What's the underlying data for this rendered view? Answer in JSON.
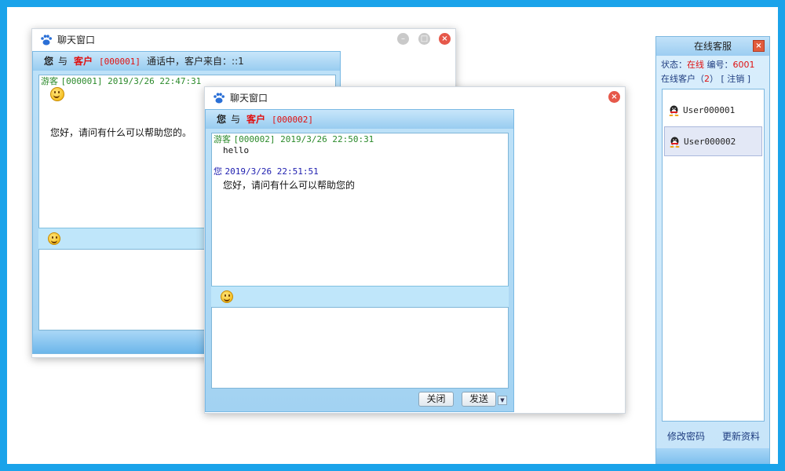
{
  "window1": {
    "title": "聊天窗口",
    "header": {
      "you": "您",
      "with": "与",
      "role": "客户",
      "code": "[000001]",
      "status": "通话中，客户来自：::1"
    },
    "messages": [
      {
        "sender": "游客",
        "meta": "[000001] 2019/3/26 22:47:31",
        "emoji": "grin-emoji"
      },
      {
        "text": "您好，请问有什么可以帮助您的。"
      }
    ]
  },
  "window2": {
    "title": "聊天窗口",
    "header": {
      "you": "您",
      "with": "与",
      "role": "客户",
      "code": "[000002]"
    },
    "messages": [
      {
        "sender": "游客",
        "meta": "[000002] 2019/3/26 22:50:31",
        "text": "hello"
      },
      {
        "sender": "您",
        "meta": "2019/3/26 22:51:51",
        "text": "您好，请问有什么可以帮助您的"
      }
    ],
    "close_label": "关闭",
    "send_label": "发送"
  },
  "sidebar": {
    "title": "在线客服",
    "status_label": "状态：",
    "status_value": "在线",
    "id_label": "编号：",
    "id_value": "6001",
    "online_label": "在线客户（",
    "online_count": "2",
    "online_close": "）",
    "logout_label": "[ 注销 ]",
    "users": [
      "User000001",
      "User000002"
    ],
    "change_password": "修改密码",
    "update_profile": "更新资料"
  },
  "colors": {
    "frame": "#1aa3ea",
    "accent_red": "#e01010",
    "guest_green": "#2b8a2b",
    "self_blue": "#2020b0"
  }
}
